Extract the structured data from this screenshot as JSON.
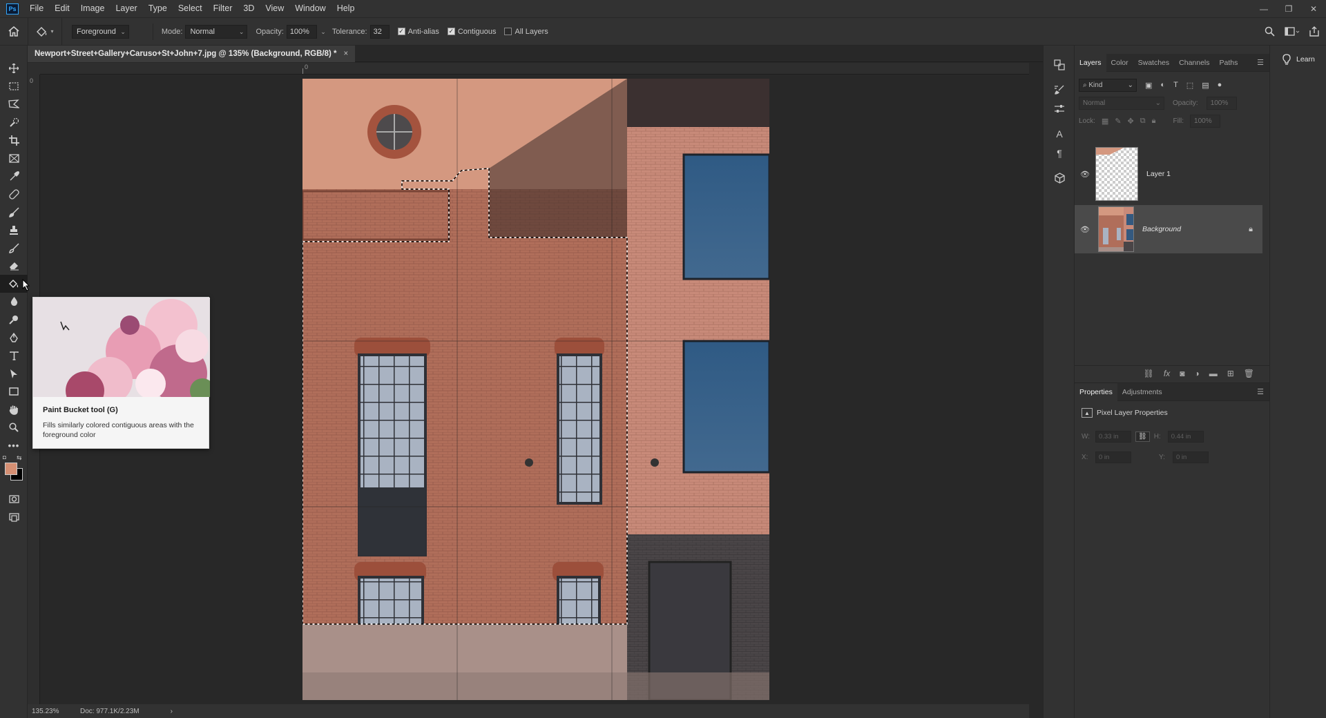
{
  "app": {
    "logo": "Ps"
  },
  "menu": [
    "File",
    "Edit",
    "Image",
    "Layer",
    "Type",
    "Select",
    "Filter",
    "3D",
    "View",
    "Window",
    "Help"
  ],
  "window_controls": {
    "minimize": "—",
    "restore": "❐",
    "close": "✕"
  },
  "options": {
    "fill_source": "Foreground",
    "mode_label": "Mode:",
    "mode_value": "Normal",
    "opacity_label": "Opacity:",
    "opacity_value": "100%",
    "tolerance_label": "Tolerance:",
    "tolerance_value": "32",
    "anti_alias_label": "Anti-alias",
    "anti_alias_checked": true,
    "contiguous_label": "Contiguous",
    "contiguous_checked": true,
    "all_layers_label": "All Layers",
    "all_layers_checked": false
  },
  "document": {
    "tab_title": "Newport+Street+Gallery+Caruso+St+John+7.jpg @ 135% (Background, RGB/8) *",
    "close_glyph": "×",
    "ruler_zero": "0"
  },
  "status": {
    "zoom": "135.23%",
    "doc_size": "Doc: 977.1K/2.23M",
    "arrow": "›"
  },
  "tooltip": {
    "title": "Paint Bucket tool (G)",
    "description": "Fills similarly colored contiguous areas with the foreground color"
  },
  "colors": {
    "foreground": "#d58f73",
    "background": "#000000",
    "accent": "#31a8ff"
  },
  "layers_panel": {
    "tabs": [
      "Layers",
      "Color",
      "Swatches",
      "Channels",
      "Paths"
    ],
    "active_tab": "Layers",
    "filter_kind": "Kind",
    "blend_mode": "Normal",
    "opacity_label": "Opacity:",
    "opacity_value": "100%",
    "lock_label": "Lock:",
    "fill_label": "Fill:",
    "fill_value": "100%",
    "layers": [
      {
        "name": "Layer 1",
        "visible": true,
        "selected": false,
        "locked": false
      },
      {
        "name": "Background",
        "visible": true,
        "selected": true,
        "locked": true
      }
    ]
  },
  "properties_panel": {
    "tabs": [
      "Properties",
      "Adjustments"
    ],
    "active_tab": "Properties",
    "section_title": "Pixel Layer Properties",
    "w_label": "W:",
    "w_value": "0.33 in",
    "h_label": "H:",
    "h_value": "0.44 in",
    "x_label": "X:",
    "x_value": "0 in",
    "y_label": "Y:",
    "y_value": "0 in"
  },
  "learn": {
    "label": "Learn"
  }
}
